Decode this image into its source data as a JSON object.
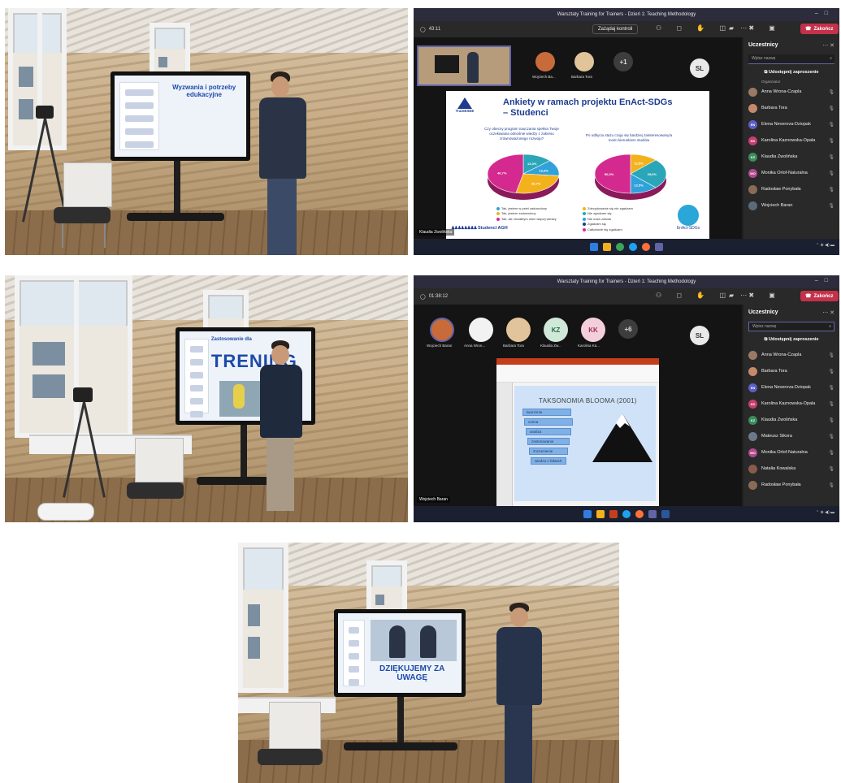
{
  "teams_top": {
    "window_title": "Warsztaty Training for Trainers - Dzień 1: Teaching Methodology",
    "timer": "43:11",
    "request_control": "Zażądaj kontroli",
    "end_button": "Zakończ",
    "sidebar_title": "Uczestnicy",
    "search_placeholder": "Wpisz nazwę",
    "share_invite": "Udostępnij zaproszenie",
    "organizer_label": "Organizator",
    "tiles": [
      {
        "label": "Wojciech Ba...",
        "initials": ""
      },
      {
        "label": "Barbara Tora",
        "initials": ""
      },
      {
        "label": "",
        "initials": "+1"
      },
      {
        "label": "",
        "initials": "SL"
      }
    ],
    "participants": [
      {
        "name": "Anna Wrona-Czapla",
        "initials": "",
        "color": "#9a7a64"
      },
      {
        "name": "Barbara Tora",
        "initials": "",
        "color": "#c48a6a"
      },
      {
        "name": "Elena Neverova-Dziopak",
        "initials": "EN",
        "color": "#5b5fc7"
      },
      {
        "name": "Karolina Kaznowska-Opala",
        "initials": "KK",
        "color": "#c43e6f"
      },
      {
        "name": "Klaudia Zwolińska",
        "initials": "KZ",
        "color": "#3a8d5c"
      },
      {
        "name": "Monika Orlof-Naturalna",
        "initials": "MO",
        "color": "#b04a8e"
      },
      {
        "name": "Radosław Ponybała",
        "initials": "",
        "color": "#8a6b55"
      },
      {
        "name": "Wojciech Baran",
        "initials": "",
        "color": "#5b6b7a"
      }
    ],
    "presenter_tag": "Klaudia Zwolińska",
    "slide": {
      "logo": "TrainESEE",
      "title_line1": "Ankiety w ramach projektu EnAct-SDGs",
      "title_line2": "– Studenci",
      "q1": "Czy obecny program nauczania spełnia Twoje oczekiwania odnośnie wiedzy z zakresu zrównoważonego rozwoju?",
      "q2": "Po odbyciu stażu czuję się bardziej zainteresowany/a moim kierunkiem studiów",
      "legend1": [
        "Tak, jestem w pełni zadowolony",
        "Tak, jestem zadowolony",
        "Tak, ale chciałbym mieć więcej wiedzy"
      ],
      "legend2": [
        "Zdecydowanie się nie zgadzam",
        "Nie zgadzam się",
        "Nie mam zdania",
        "Zgadzam się",
        "Całkowicie się zgadzam"
      ],
      "footer_left": "Studenci AGH",
      "footer_logo": "EnAct-SDGs",
      "pie1": [
        {
          "label": "13,3%",
          "value": 13.3,
          "color": "#2aa6b8"
        },
        {
          "label": "13,3%",
          "value": 13.3,
          "color": "#31a1d9"
        },
        {
          "label": "26,7%",
          "value": 26.7,
          "color": "#f3b21b"
        },
        {
          "label": "46,7%",
          "value": 46.7,
          "color": "#d42a8f"
        }
      ],
      "pie2": [
        {
          "label": "12,5%",
          "value": 12.5,
          "color": "#f3b21b"
        },
        {
          "label": "25,0%",
          "value": 25.0,
          "color": "#2aa6b8"
        },
        {
          "label": "12,5%",
          "value": 12.5,
          "color": "#31a1d9"
        },
        {
          "label": "50,0%",
          "value": 50.0,
          "color": "#d42a8f"
        }
      ]
    }
  },
  "teams_mid": {
    "window_title": "Warsztaty Training for Trainers - Dzień 1: Teaching Methodology",
    "timer": "01:38:12",
    "end_button": "Zakończ",
    "sidebar_title": "Uczestnicy",
    "search_placeholder": "Wpisz nazwę",
    "share_invite": "Udostępnij zaproszenie",
    "tiles": [
      {
        "label": "Wojciech Baran",
        "initials": ""
      },
      {
        "label": "Anna Wron...",
        "initials": ""
      },
      {
        "label": "Barbara Tora",
        "initials": ""
      },
      {
        "label": "Klaudia Zw...",
        "initials": "KZ"
      },
      {
        "label": "Karolina Ka...",
        "initials": "KK"
      },
      {
        "label": "",
        "initials": "+6"
      },
      {
        "label": "",
        "initials": "SL"
      }
    ],
    "participants": [
      {
        "name": "Anna Wrona-Czapla",
        "initials": "",
        "color": "#9a7a64"
      },
      {
        "name": "Barbara Tora",
        "initials": "",
        "color": "#c48a6a"
      },
      {
        "name": "Elena Neverova-Dziopak",
        "initials": "EN",
        "color": "#5b5fc7"
      },
      {
        "name": "Karolina Kaznowska-Opala",
        "initials": "KK",
        "color": "#c43e6f"
      },
      {
        "name": "Klaudia Zwolińska",
        "initials": "KZ",
        "color": "#3a8d5c"
      },
      {
        "name": "Mateusz Sikora",
        "initials": "",
        "color": "#6b7a8a"
      },
      {
        "name": "Monika Orlof-Naturalna",
        "initials": "MO",
        "color": "#b04a8e"
      },
      {
        "name": "Natalia Kowalska",
        "initials": "",
        "color": "#8a5a4a"
      },
      {
        "name": "Radosław Ponybała",
        "initials": "",
        "color": "#8a6b55"
      }
    ],
    "presenter_tag": "Wojciech Baran",
    "slide": {
      "title": "TAKSONOMIA BLOOMA (2001)",
      "steps": [
        "tworzenie",
        "ocena",
        "analiza",
        "zastosowanie",
        "zrozumienie",
        "wiedza o faktach"
      ]
    }
  },
  "photos": {
    "p1_slide_title": "Wyzwania i potrzeby edukacyjne",
    "p2_slide_word": "TRENING",
    "p2_slide_caption": "Zastosowanie dla",
    "p3_slide_title": "DZIĘKUJEMY ZA UWAGĘ"
  },
  "colors": {
    "teams_end": "#c4314b",
    "teams_accent": "#6264a7",
    "slide_blue": "#1d3c8f"
  }
}
